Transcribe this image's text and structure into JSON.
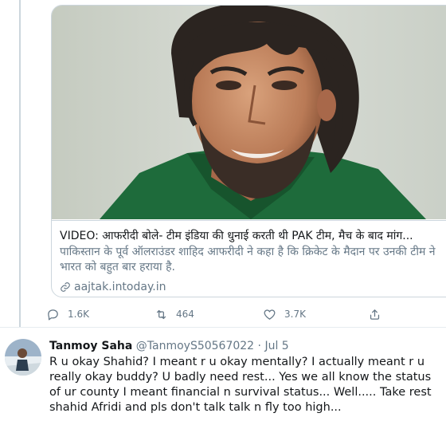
{
  "card": {
    "title": "VIDEO: आफरीदी बोले- टीम इंडिया की धुनाई करती थी PAK टीम, मैच के बाद मांग...",
    "description": "पाकिस्तान के पूर्व ऑलराउंडर शाहिद आफरीदी ने कहा है कि क्रिकेट के मैदान पर उनकी टीम ने भारत को बहुत बार हराया है.",
    "domain": "aajtak.intoday.in"
  },
  "actions": {
    "reply_count": "1.6K",
    "retweet_count": "464",
    "like_count": "3.7K"
  },
  "reply_tweet": {
    "name": "Tanmoy Saha",
    "handle": "@TanmoyS50567022",
    "separator": "·",
    "date": "Jul 5",
    "text": "R u okay Shahid? I meant r u okay mentally? I actually meant r u really okay buddy? U badly need rest... Yes we all know the status of ur county I meant financial n survival status... Well..... Take rest shahid Afridi and pls don't talk talk n fly too high..."
  },
  "colors": {
    "secondary_text": "#657786",
    "border": "#ccd6dd",
    "jersey_green": "#1e6b3b"
  }
}
